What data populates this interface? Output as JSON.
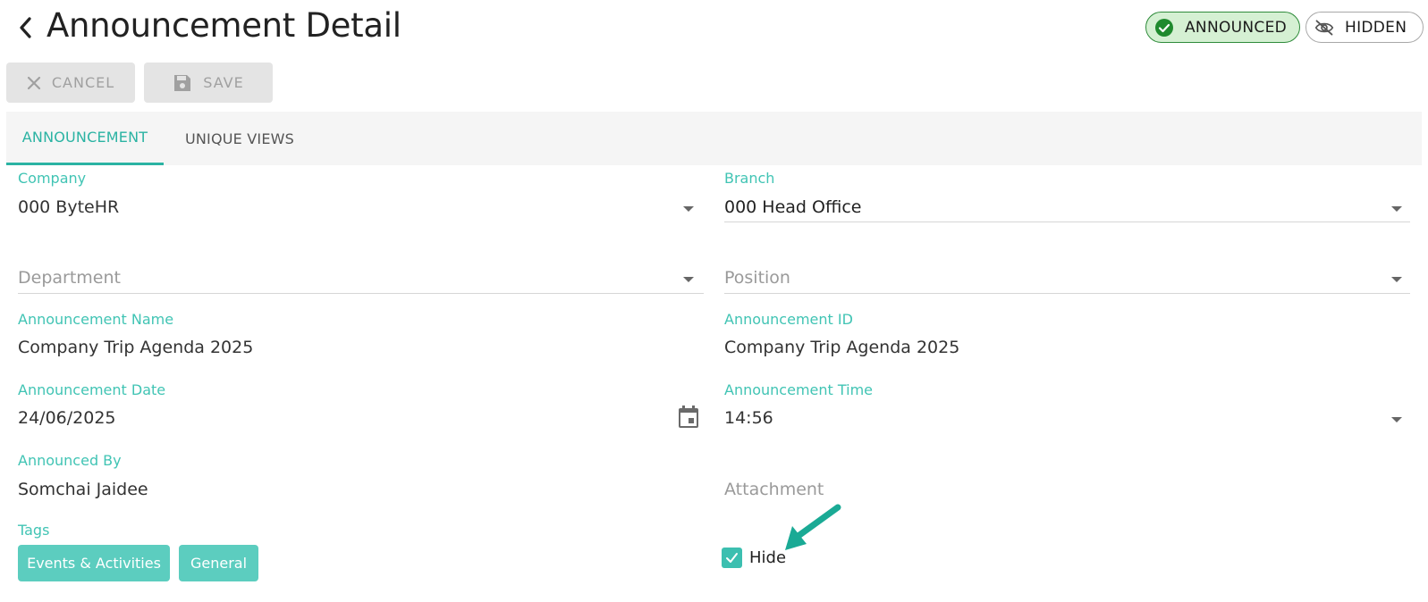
{
  "header": {
    "title": "Announcement Detail",
    "back_icon": "chevron-left-icon"
  },
  "status_badges": [
    {
      "label": "ANNOUNCED",
      "icon": "check-circle-icon",
      "color": "#2e8b3a"
    },
    {
      "label": "HIDDEN",
      "icon": "eye-off-icon",
      "color": "#555555"
    }
  ],
  "toolbar": {
    "cancel_label": "CANCEL",
    "save_label": "SAVE"
  },
  "tabs": [
    {
      "label": "ANNOUNCEMENT",
      "active": true
    },
    {
      "label": "UNIQUE VIEWS",
      "active": false
    }
  ],
  "form": {
    "company": {
      "label": "Company",
      "value": "000 ByteHR"
    },
    "branch": {
      "label": "Branch",
      "value": "000 Head Office"
    },
    "department": {
      "placeholder": "Department"
    },
    "position": {
      "placeholder": "Position"
    },
    "announcement_name": {
      "label": "Announcement Name",
      "value": "Company Trip Agenda 2025"
    },
    "announcement_id": {
      "label": "Announcement ID",
      "value": "Company Trip Agenda 2025"
    },
    "announcement_date": {
      "label": "Announcement Date",
      "value": "24/06/2025"
    },
    "announcement_time": {
      "label": "Announcement Time",
      "value": "14:56"
    },
    "announced_by": {
      "label": "Announced By",
      "value": "Somchai Jaidee"
    },
    "attachment": {
      "placeholder": "Attachment"
    },
    "tags": {
      "label": "Tags",
      "items": [
        "Events & Activities",
        "General"
      ]
    },
    "hide": {
      "label": "Hide",
      "checked": true
    }
  },
  "colors": {
    "accent": "#2bb3a3",
    "label": "#41c4b4",
    "tag_bg": "#5ccdbf",
    "arrow": "#1aaa95"
  }
}
